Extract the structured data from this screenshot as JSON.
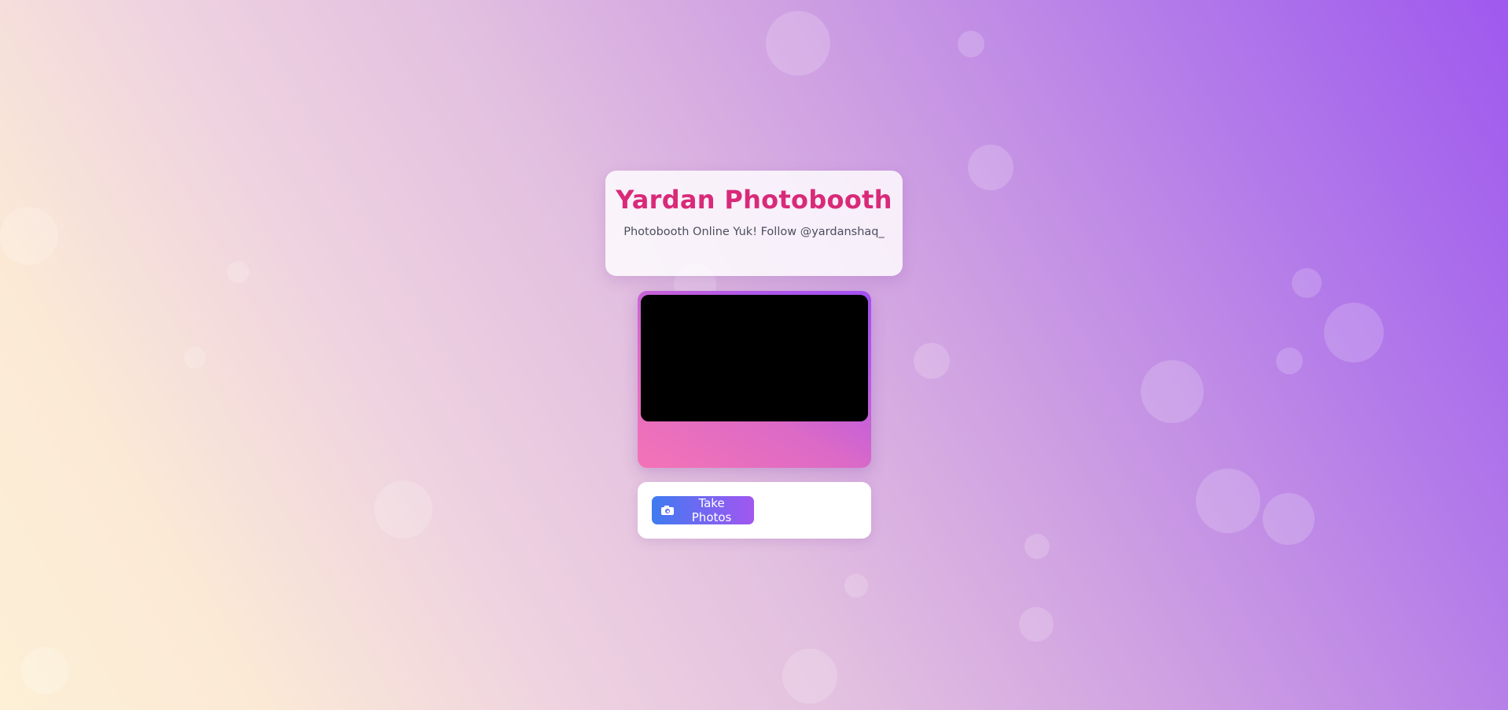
{
  "header": {
    "title": "Yardan Photobooth",
    "subtitle": "Photobooth Online Yuk! Follow @yardanshaq_"
  },
  "camera": {
    "preview_state": "black"
  },
  "controls": {
    "take_photos_label": "Take Photos",
    "take_photos_icon": "camera-icon"
  },
  "colors": {
    "title": "#d92a79",
    "button_start": "#3f7bf0",
    "button_end": "#a257f0",
    "frame_start": "#f473b6",
    "frame_end": "#a24ff0"
  }
}
